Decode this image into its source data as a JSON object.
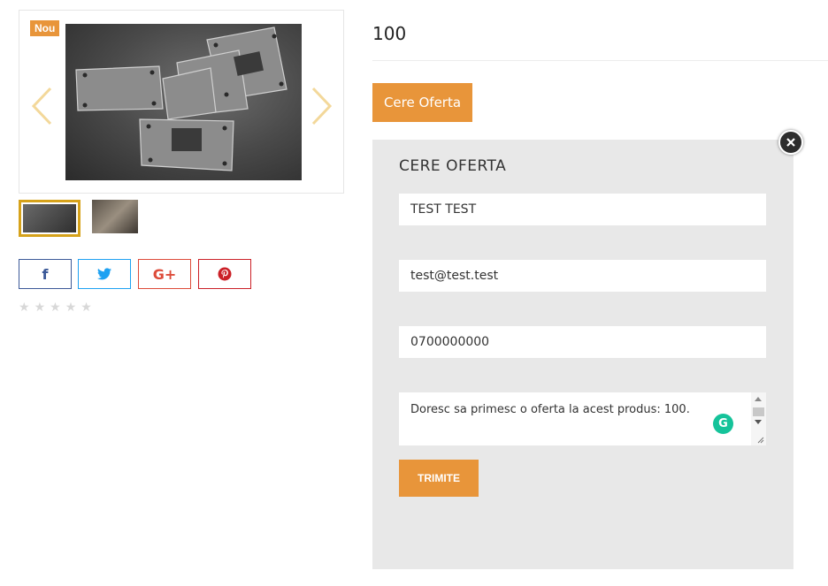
{
  "gallery": {
    "badge": "Nou",
    "main_image": "metal-plates-photo",
    "thumbnails": [
      "thumbnail-1",
      "thumbnail-2"
    ],
    "selected_thumbnail": 1
  },
  "social": {
    "facebook_icon": "f",
    "twitter_icon": "twitter-bird-icon",
    "googleplus_icon": "G+",
    "pinterest_icon": "pinterest-icon"
  },
  "rating": {
    "stars_filled": 0,
    "stars_total": 5
  },
  "product": {
    "title": "100",
    "offer_button": "Cere Oferta"
  },
  "modal": {
    "title": "CERE OFERTA",
    "name_value": "TEST TEST",
    "email_value": "test@test.test",
    "phone_value": "0700000000",
    "message_value": "Doresc sa primesc o oferta la acest produs: 100.",
    "submit_label": "TRIMITE"
  },
  "colors": {
    "accent": "#e8953a",
    "modal_bg": "#e8e8e8",
    "thumb_selected_border": "#d6a21a",
    "facebook": "#3b5998",
    "twitter": "#1da1f2",
    "googleplus": "#dd4b39",
    "pinterest": "#cb2027",
    "grammarly": "#15c39a"
  }
}
